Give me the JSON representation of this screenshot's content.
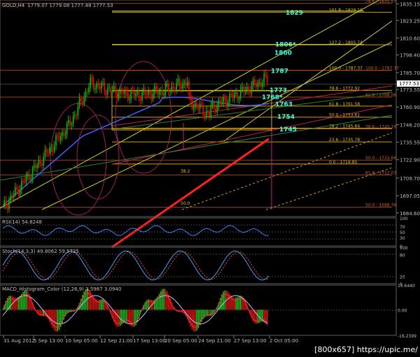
{
  "header": {
    "symbol": "GOLD,H4",
    "ohlc": "1779.07 1779.08 1777.48 1777.53"
  },
  "colors": {
    "background": "#000000",
    "bull": "#00c000",
    "bear": "#ff0000",
    "fib": "#d4a000",
    "fib_label": "#e0c020",
    "cyan": "#40ffe0",
    "ma_blue": "#4060ff",
    "ma_red": "#ff2020",
    "magenta": "#c01060",
    "axis_text": "#c0c0c0",
    "price_tag_bg": "#ffffff"
  },
  "watermark": "[800x657] https://upic.me/",
  "chart_data": [
    {
      "type": "candlestick",
      "title": "GOLD,H4",
      "x_ticks": [
        "31 Aug 2012",
        "5 Sep 13:00",
        "10 Sep 05:00",
        "12 Sep 21:00",
        "17 Sep 13:00",
        "20 Sep 05:00",
        "24 Sep 21:00",
        "27 Sep 13:00",
        "2 Oct 05:00"
      ],
      "y_ticks": [
        1835.15,
        1823.25,
        1810.6,
        1798.4,
        1785.7,
        1773.55,
        1760.9,
        1748.2,
        1735.55,
        1722.9,
        1709.7,
        1697.05,
        1684.6
      ],
      "ylim": [
        1682,
        1838
      ],
      "last_price": 1777.53,
      "fib_levels": [
        {
          "label": "161.8 - 1829.10",
          "value": 1829.1
        },
        {
          "label": "127.2 - 1805.74",
          "value": 1805.74
        },
        {
          "label": "100.0 - 1787.37",
          "value": 1787.37
        },
        {
          "label": "78.6 - 1772.92",
          "value": 1772.92
        },
        {
          "label": "61.8 - 1761.58",
          "value": 1761.58
        },
        {
          "label": "50.0 - 1753.61",
          "value": 1753.61
        },
        {
          "label": "38.2 - 1745.64",
          "value": 1745.64
        },
        {
          "label": "23.6 - 1735.78",
          "value": 1735.78
        },
        {
          "label": "0.0 - 1719.85",
          "value": 1719.85
        }
      ],
      "fib_levels_right": [
        {
          "label": "78.6 - 1835.57",
          "value": 1835.57
        },
        {
          "label": "100.0 - 1787.37",
          "value": 1787.37
        },
        {
          "label": "61.8 - 1768.06",
          "value": 1768.06
        },
        {
          "label": "78.6 - 1745.16",
          "value": 1745.16
        },
        {
          "label": "50.0 - 1722.66",
          "value": 1722.66
        },
        {
          "label": "61.8 - 1712.03",
          "value": 1712.03
        },
        {
          "label": "50.0 - 1688.76",
          "value": 1688.76
        }
      ],
      "fib_small_labels": [
        "38.2",
        "50.0"
      ],
      "level_annotations": [
        {
          "label": "1829",
          "value": 1829
        },
        {
          "label": "1806*",
          "value": 1806
        },
        {
          "label": "1800",
          "value": 1800
        },
        {
          "label": "1787",
          "value": 1787
        },
        {
          "label": "1773",
          "value": 1773
        },
        {
          "label": "1768*",
          "value": 1768
        },
        {
          "label": "1763",
          "value": 1763
        },
        {
          "label": "1754",
          "value": 1754
        },
        {
          "label": "1745",
          "value": 1745
        }
      ]
    },
    {
      "type": "line",
      "title": "RSI(14) 54.8248",
      "y_ticks": [
        100,
        70,
        50,
        30,
        0
      ],
      "ylim": [
        0,
        100
      ],
      "last_value": 54.8248
    },
    {
      "type": "line",
      "title": "Stoch(14,3,3) 49.8062 59.5725",
      "y_ticks": [
        100,
        80,
        20,
        0
      ],
      "ylim": [
        0,
        100
      ]
    },
    {
      "type": "bar",
      "title": "MACD_Histogram_Color (12,26,9) 3.5987 3.0940",
      "y_ticks": [
        15.644,
        0.0,
        -16.2399
      ],
      "ylim": [
        -16.2399,
        15.644
      ]
    }
  ]
}
